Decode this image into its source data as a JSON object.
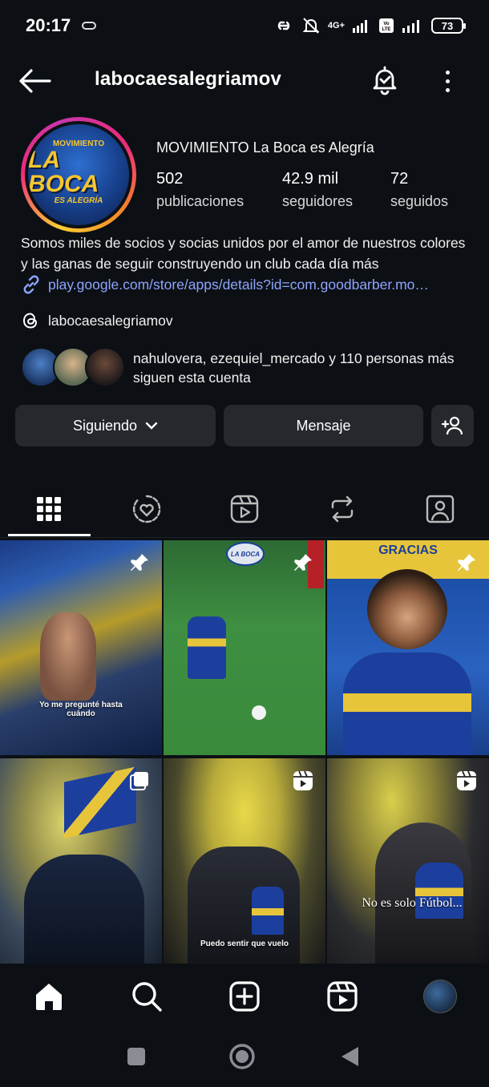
{
  "status_bar": {
    "time": "20:17",
    "network_label": "4G+",
    "volte_label": "Vo LTE",
    "battery": "73"
  },
  "header": {
    "username": "labocaesalegriamov"
  },
  "profile": {
    "avatar_text_top": "MOVIMIENTO",
    "avatar_text_main": "LA BOCA",
    "avatar_text_sub": "ES ALEGRÍA",
    "display_name": "MOVIMIENTO La Boca es Alegría",
    "stats": [
      {
        "value": "502",
        "label": "publicaciones"
      },
      {
        "value": "42.9 mil",
        "label": "seguidores"
      },
      {
        "value": "72",
        "label": "seguidos"
      }
    ],
    "bio": "Somos miles de socios y socias unidos por el amor de nuestros colores y las ganas de seguir construyendo un club cada día más",
    "link": "play.google.com/store/apps/details?id=com.goodbarber.mo…",
    "threads_handle": "labocaesalegriamov",
    "followed_by": "nahulovera, ezequiel_mercado y 110 personas más siguen esta cuenta"
  },
  "actions": {
    "following_label": "Siguiendo",
    "message_label": "Mensaje"
  },
  "tabs": [
    "grid",
    "liked",
    "reels",
    "reposts",
    "tagged"
  ],
  "posts": [
    {
      "caption": "Yo me pregunté hasta cuándo",
      "badge": "pin"
    },
    {
      "caption": "",
      "badge": "pin",
      "overlay_logo": "LA BOCA"
    },
    {
      "caption": "GRACIAS",
      "badge": "pin"
    },
    {
      "caption": "",
      "badge": "carousel"
    },
    {
      "caption": "Puedo sentir que vuelo",
      "badge": "reel"
    },
    {
      "caption": "No es solo Fútbol...",
      "badge": "reel"
    }
  ],
  "colors": {
    "background": "#0c1014",
    "button": "#25292e",
    "link": "#8ea4ff",
    "boca_blue": "#1a3f9b",
    "boca_yellow": "#f6c62e"
  }
}
